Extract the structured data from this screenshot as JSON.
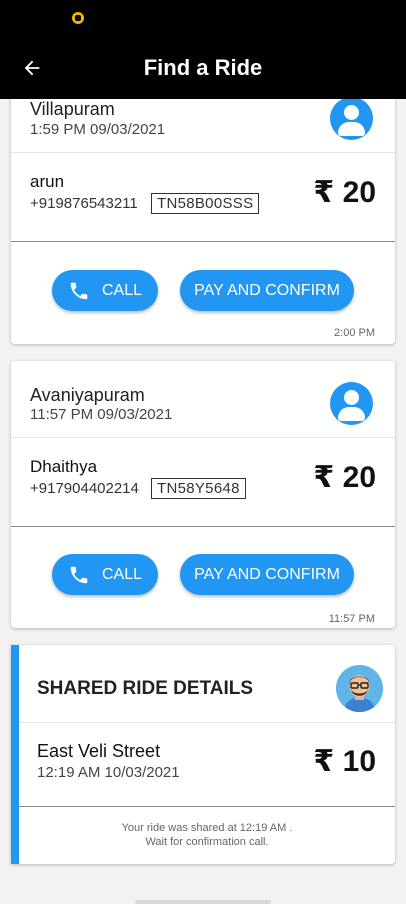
{
  "app_bar": {
    "title": "Find a Ride"
  },
  "rides": [
    {
      "place": "Villapuram",
      "timestamp": "1:59 PM 09/03/2021",
      "driver_name": "arun",
      "phone": "+919876543211",
      "plate": "TN58B00SSS",
      "fare": "₹ 20",
      "call_label": "CALL",
      "pay_label": "PAY AND CONFIRM",
      "time_note": "2:00 PM"
    },
    {
      "place": "Avaniyapuram",
      "timestamp": "11:57 PM 09/03/2021",
      "driver_name": "Dhaithya",
      "phone": "+917904402214",
      "plate": "TN58Y5648",
      "fare": "₹ 20",
      "call_label": "CALL",
      "pay_label": "PAY AND CONFIRM",
      "time_note": "11:57 PM"
    }
  ],
  "shared": {
    "title": "SHARED RIDE DETAILS",
    "place": "East Veli Street",
    "timestamp": "12:19 AM 10/03/2021",
    "fare": "₹ 10",
    "note_line1": "Your ride was shared at 12:19 AM .",
    "note_line2": "Wait for confirmation call."
  },
  "colors": {
    "accent": "#2196f3",
    "app_bar": "#000000",
    "background": "#f2f2f2"
  },
  "icons": [
    "back-arrow-icon",
    "user-icon",
    "phone-icon",
    "avatar-illustration-icon"
  ]
}
